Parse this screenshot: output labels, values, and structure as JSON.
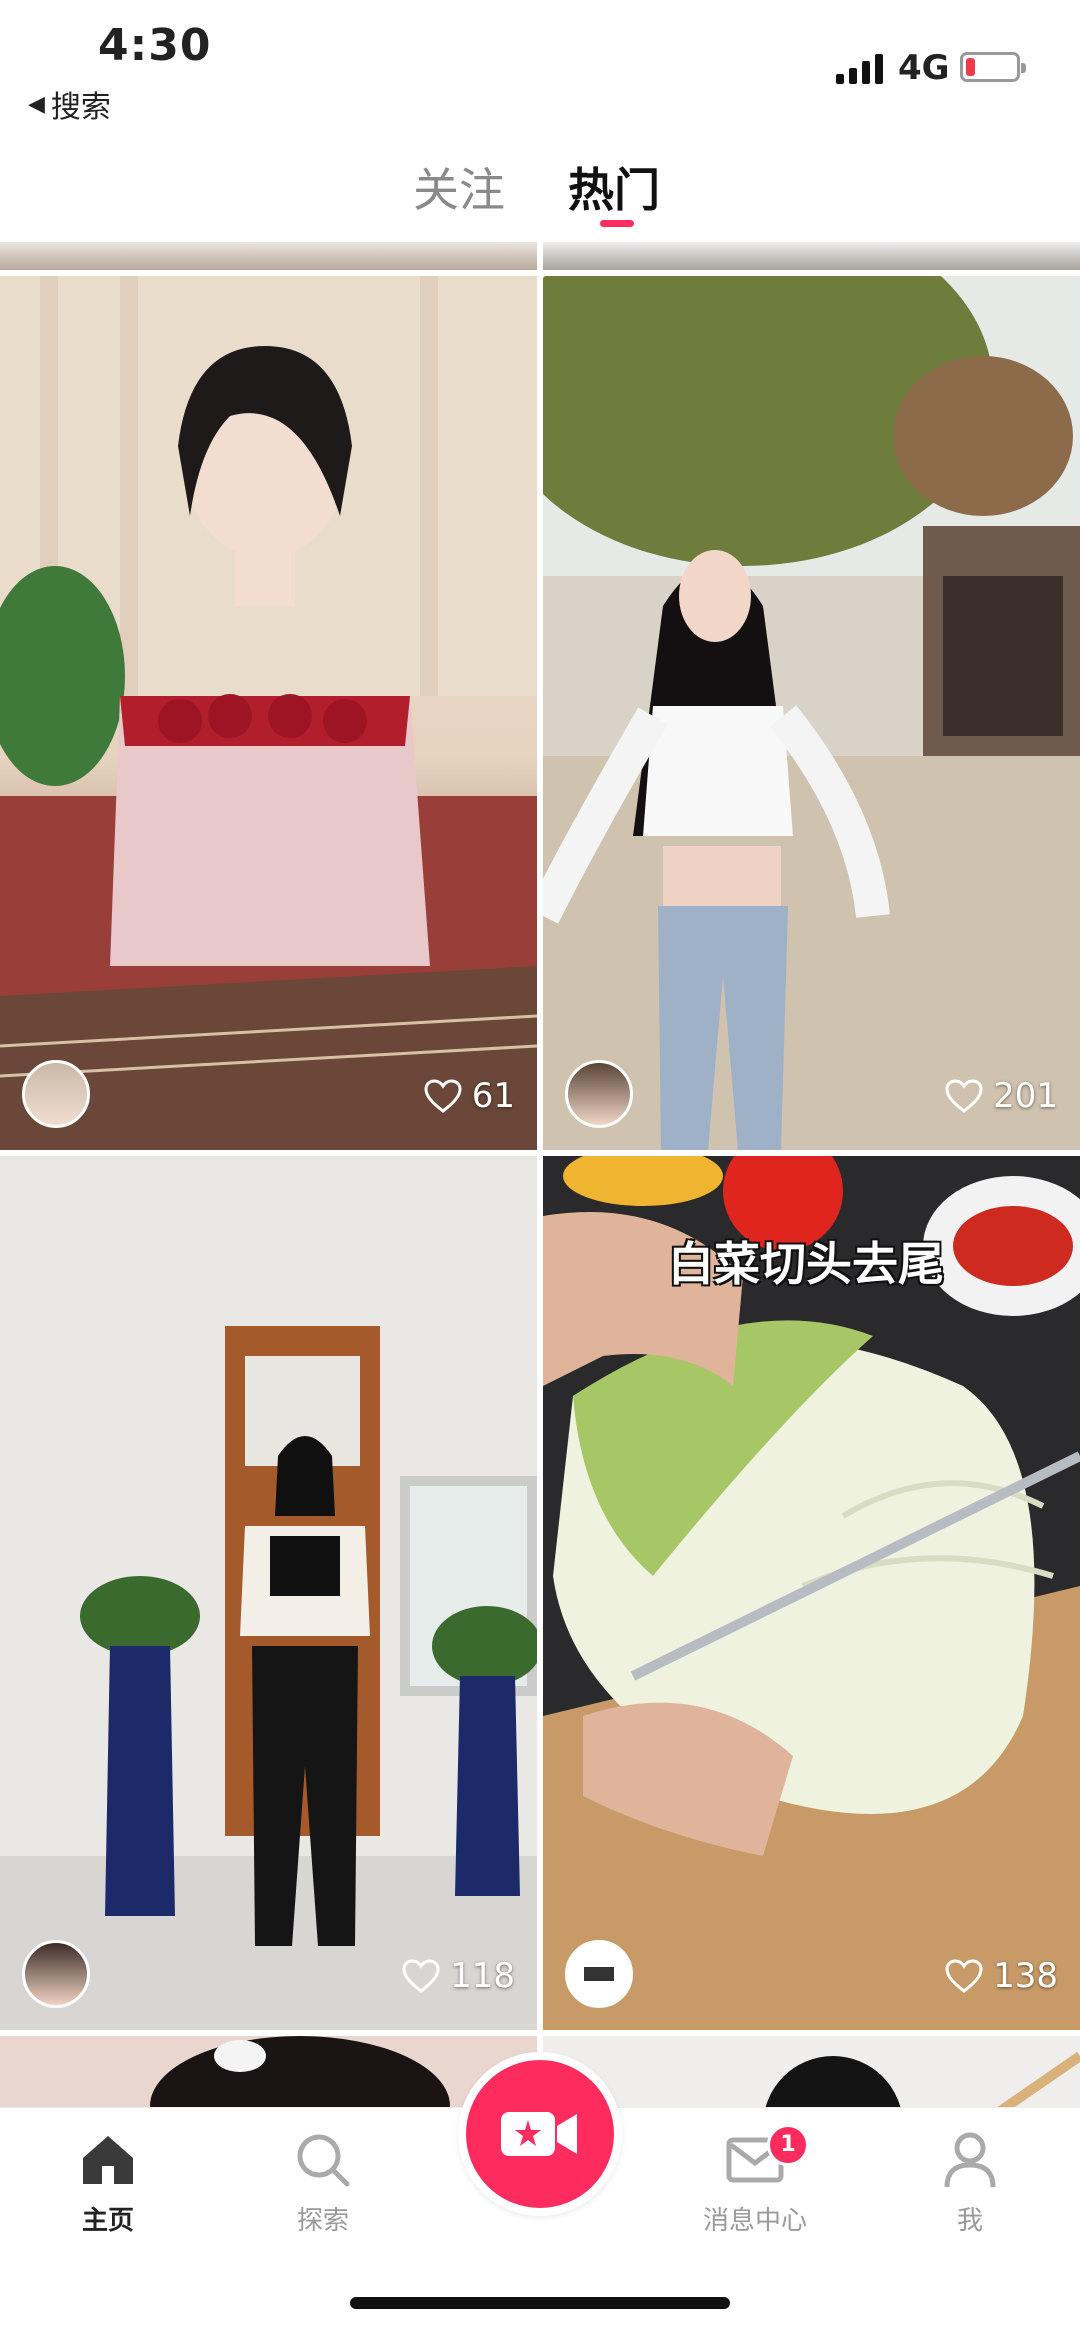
{
  "status_bar": {
    "time": "4:30",
    "back_label": "搜索",
    "network": "4G"
  },
  "tabs": {
    "follow": "关注",
    "hot": "热门"
  },
  "feed": {
    "items": [
      {
        "likes": "61",
        "caption": ""
      },
      {
        "likes": "201",
        "caption": ""
      },
      {
        "likes": "118",
        "caption": ""
      },
      {
        "likes": "138",
        "caption": "白菜切头去尾"
      }
    ]
  },
  "nav": {
    "home": "主页",
    "explore": "探索",
    "messages": "消息中心",
    "messages_badge": "1",
    "me": "我"
  },
  "colors": {
    "accent": "#fe2c5e"
  },
  "icons": {
    "status": [
      "signal-icon",
      "battery-icon"
    ],
    "nav": [
      "home-icon",
      "search-icon",
      "video-camera-icon",
      "mail-icon",
      "user-icon"
    ],
    "card": [
      "heart-icon",
      "avatar"
    ]
  }
}
